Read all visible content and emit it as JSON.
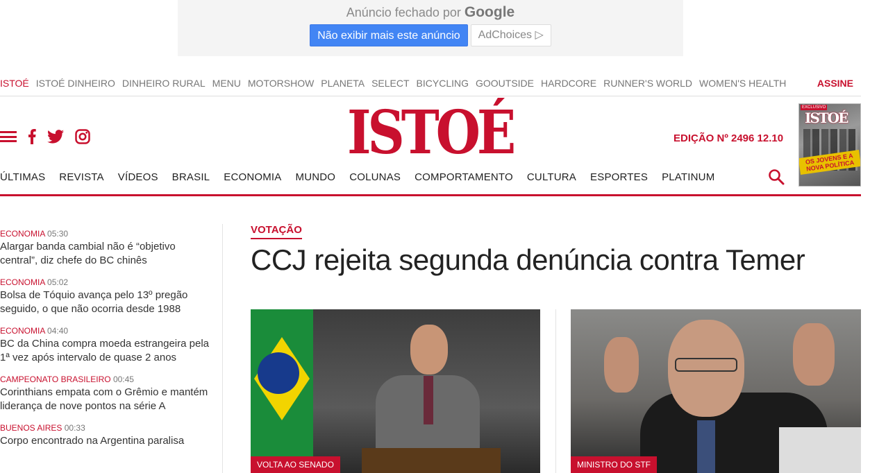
{
  "ad": {
    "closed_text": "Anúncio fechado por",
    "brand": "Google",
    "dismiss_button": "Não exibir mais este anúncio",
    "adchoices": "AdChoices ▷"
  },
  "network_nav": {
    "items": [
      "ISTOÉ",
      "ISTOÉ DINHEIRO",
      "DINHEIRO RURAL",
      "MENU",
      "MOTORSHOW",
      "PLANETA",
      "SELECT",
      "BICYCLING",
      "GOOUTSIDE",
      "HARDCORE",
      "RUNNER'S WORLD",
      "WOMEN'S HEALTH"
    ],
    "subscribe": "ASSINE"
  },
  "header": {
    "logo": "ISTOÉ",
    "edition": "EDIÇÃO Nº 2496 12.10"
  },
  "cover": {
    "tag": "EXCLUSIVO",
    "logo": "ISTOÉ",
    "headline": "OS JOVENS E A NOVA POLÍTICA"
  },
  "main_nav": {
    "items": [
      "ÚLTIMAS",
      "REVISTA",
      "VÍDEOS",
      "BRASIL",
      "ECONOMIA",
      "MUNDO",
      "COLUNAS",
      "COMPORTAMENTO",
      "CULTURA",
      "ESPORTES",
      "PLATINUM"
    ]
  },
  "sidebar": {
    "news": [
      {
        "category": "ECONOMIA",
        "time": "05:30",
        "title": "Alargar banda cambial não é “objetivo central”, diz chefe do BC chinês"
      },
      {
        "category": "ECONOMIA",
        "time": "05:02",
        "title": "Bolsa de Tóquio avança pelo 13º pregão seguido, o que não ocorria desde 1988"
      },
      {
        "category": "ECONOMIA",
        "time": "04:40",
        "title": "BC da China compra moeda estrangeira pela 1ª vez após intervalo de quase 2 anos"
      },
      {
        "category": "CAMPEONATO BRASILEIRO",
        "time": "00:45",
        "title": "Corinthians empata com o Grêmio e mantém liderança de nove pontos na série A"
      },
      {
        "category": "BUENOS AIRES",
        "time": "00:33",
        "title": "Corpo encontrado na Argentina paralisa"
      }
    ]
  },
  "main": {
    "kicker": "VOTAÇÃO",
    "headline": "CCJ rejeita segunda denúncia contra Temer",
    "photos": [
      {
        "tag": "VOLTA AO SENADO"
      },
      {
        "tag": "MINISTRO DO STF"
      }
    ]
  },
  "colors": {
    "brand": "#c8102e",
    "ad_blue": "#4285f4"
  }
}
